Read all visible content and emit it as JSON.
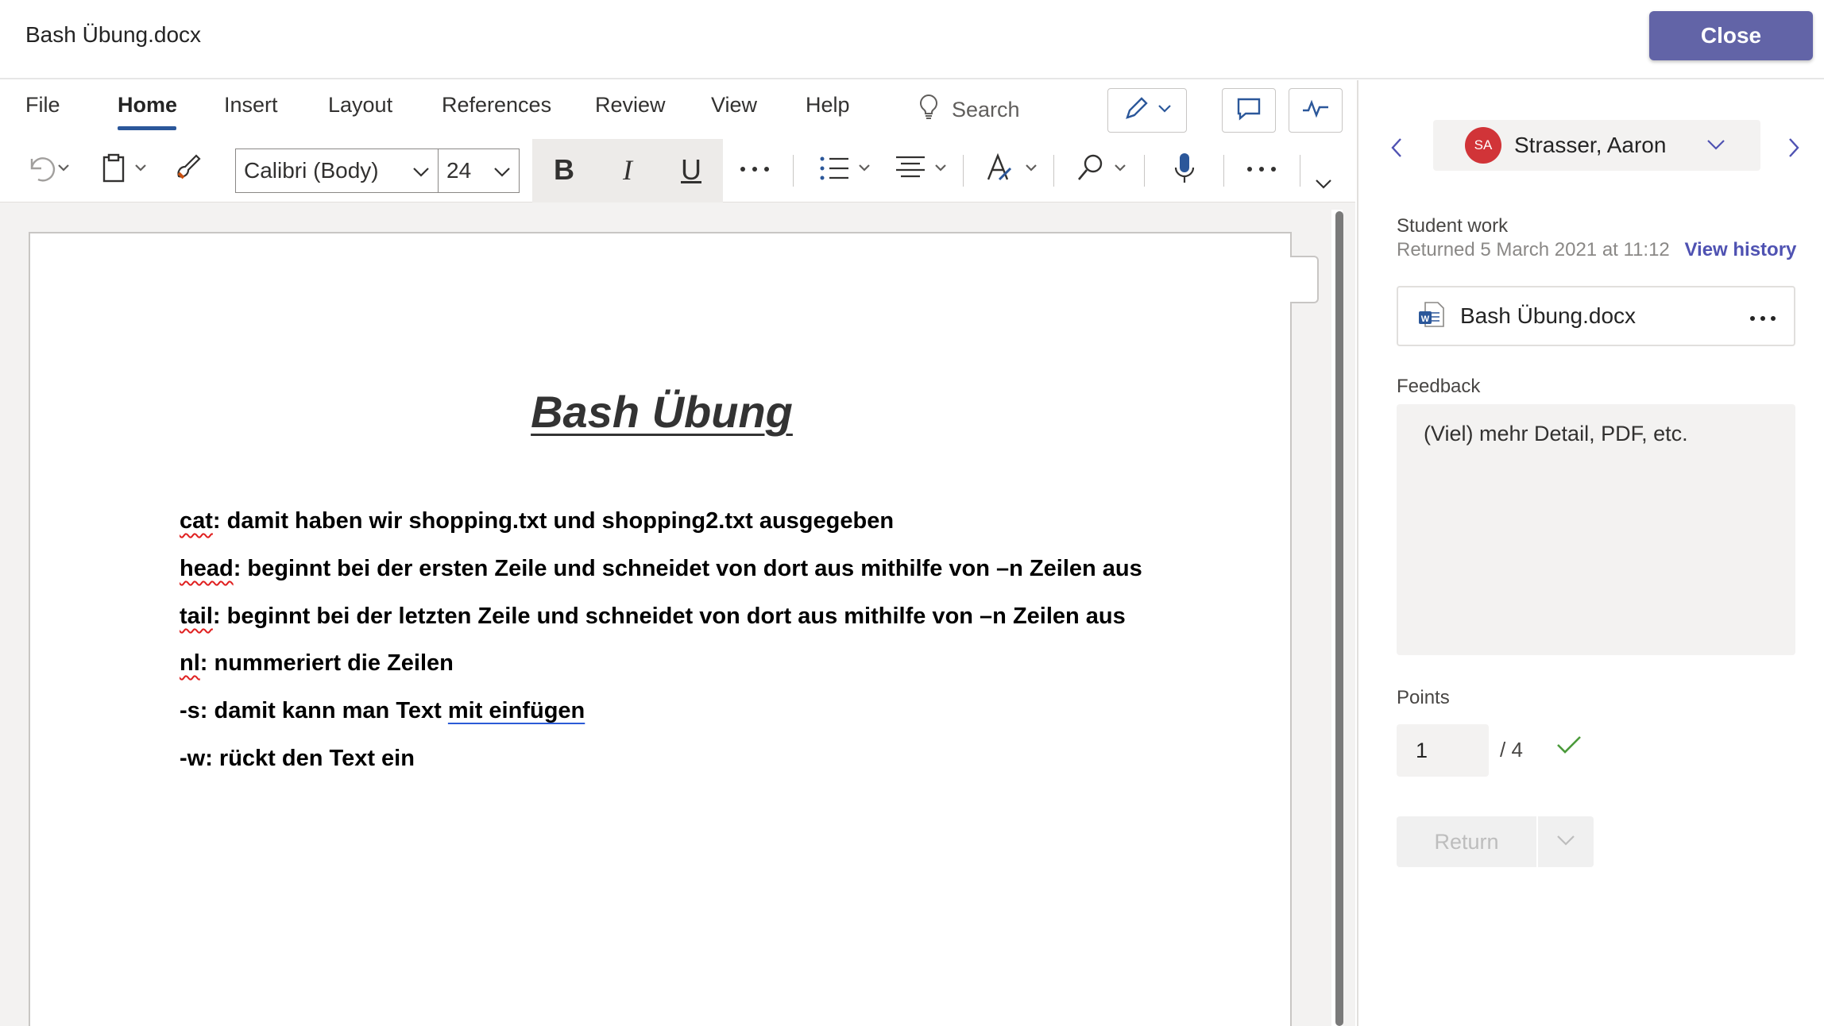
{
  "header": {
    "title": "Bash Übung.docx",
    "close_label": "Close"
  },
  "ribbon": {
    "tabs": [
      "File",
      "Home",
      "Insert",
      "Layout",
      "References",
      "Review",
      "View",
      "Help"
    ],
    "active_tab": "Home",
    "search_label": "Search",
    "font_name": "Calibri (Body)",
    "font_size": "24",
    "bold_label": "B",
    "italic_label": "I",
    "underline_label": "U"
  },
  "document": {
    "heading": "Bash Übung",
    "lines": [
      {
        "lead": "cat",
        "rest": ": damit haben wir shopping.txt und shopping2.txt ausgegeben"
      },
      {
        "lead": "head",
        "rest": ": beginnt bei der ersten Zeile und schneidet von dort aus mithilfe von –n Zeilen aus"
      },
      {
        "lead": "tail",
        "rest": ": beginnt bei der letzten Zeile und schneidet von dort aus mithilfe von –n Zeilen aus"
      },
      {
        "lead": "nl",
        "rest": ": nummeriert die Zeilen"
      },
      {
        "lead": "-s: damit kann man Text ",
        "rest": "mit einfügen"
      },
      {
        "lead": "-w: rückt den Text ein",
        "rest": ""
      }
    ]
  },
  "panel": {
    "student_initials": "SA",
    "student_name": "Strasser, Aaron",
    "student_work_label": "Student work",
    "returned_text": "Returned 5 March 2021 at 11:12",
    "view_history_label": "View history",
    "file_name": "Bash Übung.docx",
    "feedback_label": "Feedback",
    "feedback_text": "(Viel) mehr Detail, PDF, etc.",
    "points_label": "Points",
    "points_value": "1",
    "points_total": "/ 4",
    "return_label": "Return"
  },
  "colors": {
    "brand": "#6264a7",
    "word_blue": "#2b579a",
    "avatar": "#d13438",
    "check": "#4a9a3a"
  }
}
